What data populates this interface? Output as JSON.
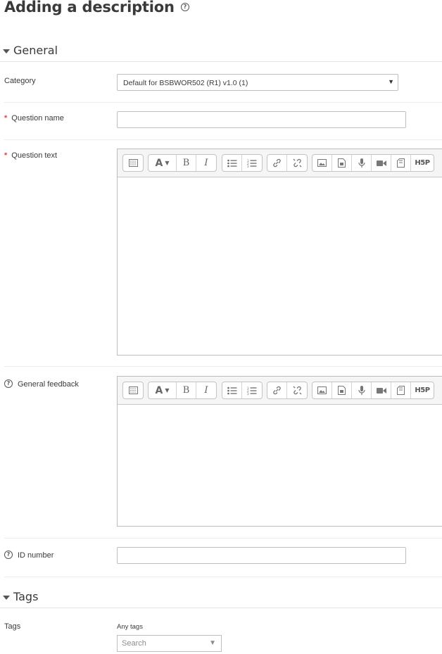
{
  "page": {
    "title": "Adding a description"
  },
  "sections": {
    "general": {
      "label": "General"
    },
    "tags": {
      "label": "Tags"
    }
  },
  "fields": {
    "category": {
      "label": "Category",
      "value": "Default for BSBWOR502 (R1) v1.0 (1)"
    },
    "question_name": {
      "label": "Question name",
      "value": ""
    },
    "question_text": {
      "label": "Question text"
    },
    "general_feedback": {
      "label": "General feedback"
    },
    "id_number": {
      "label": "ID number",
      "value": ""
    },
    "tags": {
      "label": "Tags",
      "sublabel": "Any tags",
      "placeholder": "Search"
    }
  },
  "toolbar": {
    "buttons": [
      "show-more",
      "font-style",
      "bold",
      "italic",
      "unordered-list",
      "ordered-list",
      "link",
      "unlink",
      "image",
      "media-file",
      "record-audio",
      "record-video",
      "manage-files",
      "h5p"
    ],
    "h5p_label": "H5P"
  },
  "icons": {
    "help": "?",
    "required": "*",
    "bold": "B",
    "italic": "I",
    "dropdown": "▼"
  },
  "colors": {
    "required": "#ef4040",
    "text": "#373a3c"
  }
}
